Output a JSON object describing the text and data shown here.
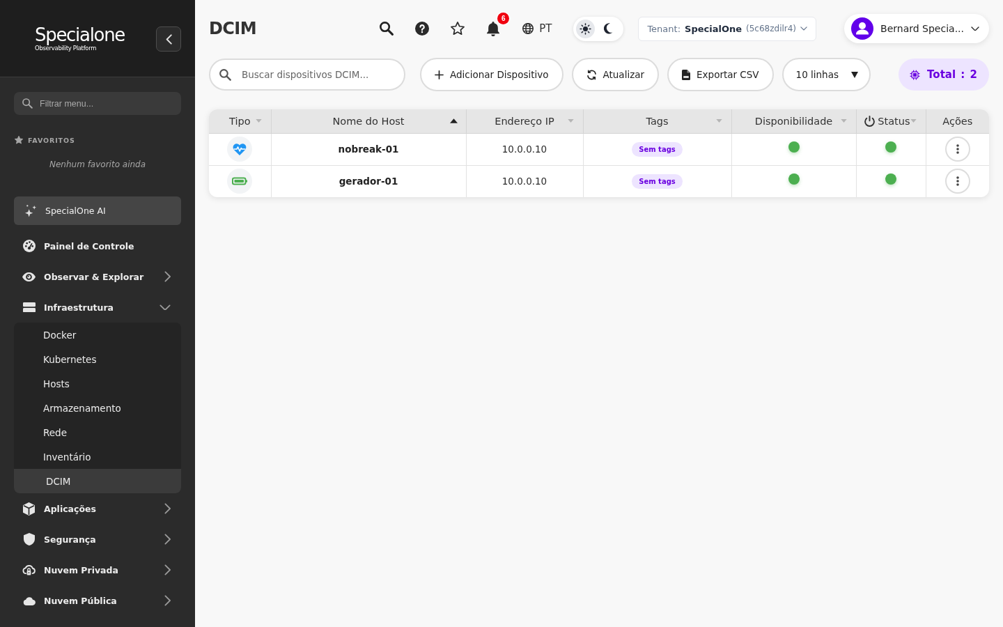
{
  "sidebar": {
    "logo": {
      "wordmark": "Specialone",
      "tagline": "Observability Platform"
    },
    "filter": {
      "placeholder": "Filtrar menu..."
    },
    "favorites": {
      "heading": "FAVORITOS",
      "empty_text": "Nenhum favorito ainda"
    },
    "ai_button": {
      "label": "SpecialOne AI"
    },
    "nav": [
      {
        "label": "Painel de Controle",
        "kind": "link"
      },
      {
        "label": "Observar & Explorar",
        "kind": "group",
        "expanded": false
      },
      {
        "label": "Infraestrutura",
        "kind": "group",
        "expanded": true,
        "children": [
          {
            "label": "Docker",
            "selected": false
          },
          {
            "label": "Kubernetes",
            "selected": false
          },
          {
            "label": "Hosts",
            "selected": false
          },
          {
            "label": "Armazenamento",
            "selected": false
          },
          {
            "label": "Rede",
            "selected": false
          },
          {
            "label": "Inventário",
            "selected": false
          },
          {
            "label": "DCIM",
            "selected": true
          }
        ]
      },
      {
        "label": "Aplicações",
        "kind": "group",
        "expanded": false
      },
      {
        "label": "Segurança",
        "kind": "group",
        "expanded": false
      },
      {
        "label": "Nuvem Privada",
        "kind": "group",
        "expanded": false
      },
      {
        "label": "Nuvem Pública",
        "kind": "group",
        "expanded": false
      }
    ]
  },
  "header": {
    "title": "DCIM",
    "notifications": {
      "count": "6"
    },
    "language": "PT",
    "theme": [
      {
        "kind": "light",
        "selected": true
      },
      {
        "kind": "dark",
        "selected": false
      }
    ],
    "tenant": {
      "label": "Tenant:",
      "name": "SpecialOne",
      "id": "(5c68zdilr4)"
    },
    "user": {
      "name": "Bernard Specia..."
    }
  },
  "toolbar": {
    "search": {
      "placeholder": "Buscar dispositivos DCIM..."
    },
    "buttons": [
      {
        "label": "Adicionar Dispositivo"
      },
      {
        "label": "Atualizar"
      },
      {
        "label": "Exportar CSV"
      }
    ],
    "page_size": {
      "value": "10 linhas"
    },
    "total": {
      "label": "Total",
      "separator": ":",
      "value": "2"
    }
  },
  "table": {
    "columns": [
      {
        "label": "Tipo",
        "kind": "text",
        "sortable": true,
        "sorted": false
      },
      {
        "label": "Nome do Host",
        "kind": "text",
        "sortable": true,
        "sorted": true
      },
      {
        "label": "Endereço IP",
        "kind": "text",
        "sortable": true,
        "sorted": false
      },
      {
        "label": "Tags",
        "kind": "text",
        "sortable": true,
        "sorted": false
      },
      {
        "label": "Disponibilidade",
        "kind": "text",
        "sortable": true,
        "sorted": false
      },
      {
        "label": "Status",
        "kind": "power",
        "sortable": true,
        "sorted": false
      },
      {
        "label": "Ações",
        "kind": "text",
        "sortable": false,
        "sorted": false
      }
    ],
    "rows": [
      {
        "kind": "ups",
        "host": "nobreak-01",
        "ip": "10.0.0.10",
        "tags": "Sem tags",
        "availability": {
          "color": "#4caf50"
        },
        "status": {
          "color": "#4caf50"
        }
      },
      {
        "kind": "generator",
        "host": "gerador-01",
        "ip": "10.0.0.10",
        "tags": "Sem tags",
        "availability": {
          "color": "#4caf50"
        },
        "status": {
          "color": "#4caf50"
        }
      }
    ]
  }
}
